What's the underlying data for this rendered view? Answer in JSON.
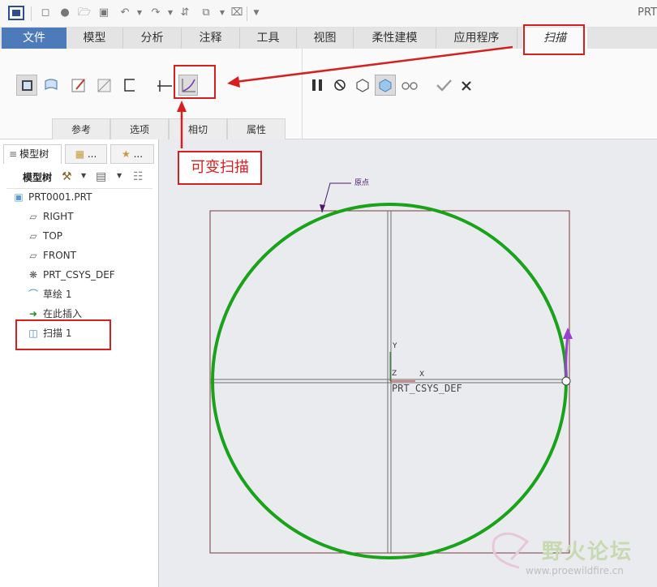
{
  "title_fragment": "PRT",
  "tabs": [
    {
      "label": "文件"
    },
    {
      "label": "模型"
    },
    {
      "label": "分析"
    },
    {
      "label": "注释"
    },
    {
      "label": "工具"
    },
    {
      "label": "视图"
    },
    {
      "label": "柔性建模"
    },
    {
      "label": "应用程序"
    },
    {
      "label": "扫描"
    }
  ],
  "ribbon": {
    "subtabs": [
      "参考",
      "选项",
      "相切",
      "属性"
    ]
  },
  "model_tree": {
    "tab1": "模型树",
    "tab_more": "...",
    "toolbar_label": "模型树",
    "items": [
      {
        "label": "PRT0001.PRT",
        "icon": "part-icon"
      },
      {
        "label": "RIGHT",
        "icon": "datum-plane-icon"
      },
      {
        "label": "TOP",
        "icon": "datum-plane-icon"
      },
      {
        "label": "FRONT",
        "icon": "datum-plane-icon"
      },
      {
        "label": "PRT_CSYS_DEF",
        "icon": "csys-icon"
      },
      {
        "label": "草绘 1",
        "icon": "sketch-icon"
      },
      {
        "label": "在此插入",
        "icon": "insert-arrow-icon"
      },
      {
        "label": "扫描 1",
        "icon": "sweep-icon"
      }
    ]
  },
  "graphics": {
    "csys_label": "PRT_CSYS_DEF",
    "start_label": "原点",
    "axis_x": "X",
    "axis_y": "Y",
    "axis_z": "Z"
  },
  "annotation": {
    "callout_text": "可变扫描"
  },
  "watermark": {
    "main": "野火论坛",
    "sub": "www.proewildfire.cn"
  },
  "colors": {
    "file_tab": "#4d7ab8",
    "sweep_trajectory": "#1aa31a",
    "annotation_red": "#d62020",
    "direction_arrow": "#9b3fd0"
  }
}
